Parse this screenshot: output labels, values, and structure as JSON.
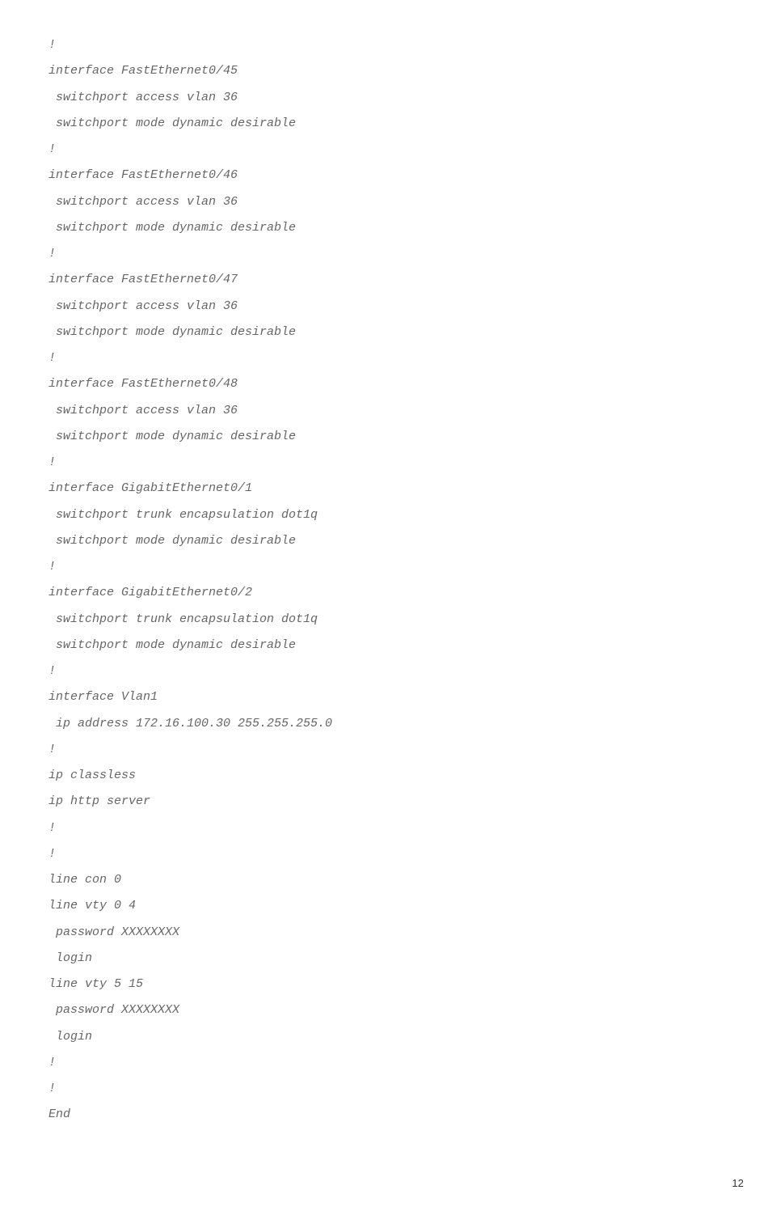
{
  "lines": [
    "!",
    "interface FastEthernet0/45",
    " switchport access vlan 36",
    " switchport mode dynamic desirable",
    "!",
    "interface FastEthernet0/46",
    " switchport access vlan 36",
    " switchport mode dynamic desirable",
    "!",
    "interface FastEthernet0/47",
    " switchport access vlan 36",
    " switchport mode dynamic desirable",
    "!",
    "interface FastEthernet0/48",
    " switchport access vlan 36",
    " switchport mode dynamic desirable",
    "!",
    "interface GigabitEthernet0/1",
    " switchport trunk encapsulation dot1q",
    " switchport mode dynamic desirable",
    "!",
    "interface GigabitEthernet0/2",
    " switchport trunk encapsulation dot1q",
    " switchport mode dynamic desirable",
    "!",
    "interface Vlan1",
    " ip address 172.16.100.30 255.255.255.0",
    "!",
    "ip classless",
    "ip http server",
    "!",
    "!",
    "line con 0",
    "line vty 0 4",
    " password XXXXXXXX",
    " login",
    "line vty 5 15",
    " password XXXXXXXX",
    " login",
    "!",
    "!",
    "End"
  ],
  "page_number": "12"
}
